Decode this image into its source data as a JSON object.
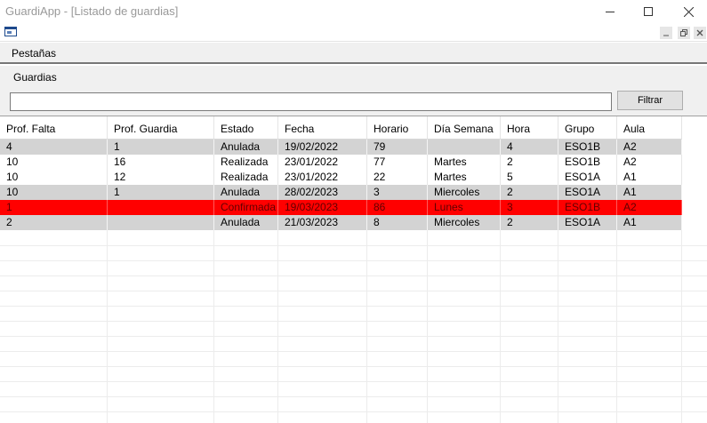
{
  "window": {
    "title": "GuardiApp - [Listado de guardias]"
  },
  "menu": {
    "items": [
      {
        "label": "Pestañas"
      }
    ]
  },
  "tabs": [
    {
      "label": "Guardias"
    }
  ],
  "filter": {
    "value": "",
    "button_label": "Filtrar"
  },
  "table": {
    "columns": [
      "Prof. Falta",
      "Prof. Guardia",
      "Estado",
      "Fecha",
      "Horario",
      "Día Semana",
      "Hora",
      "Grupo",
      "Aula"
    ],
    "rows": [
      [
        "4",
        "1",
        "Anulada",
        "19/02/2022",
        "79",
        "",
        "4",
        "ESO1B",
        "A2"
      ],
      [
        "10",
        "16",
        "Realizada",
        "23/01/2022",
        "77",
        "Martes",
        "2",
        "ESO1B",
        "A2"
      ],
      [
        "10",
        "12",
        "Realizada",
        "23/01/2022",
        "22",
        "Martes",
        "5",
        "ESO1A",
        "A1"
      ],
      [
        "10",
        "1",
        "Anulada",
        "28/02/2023",
        "3",
        "Miercoles",
        "2",
        "ESO1A",
        "A1"
      ],
      [
        "1",
        "",
        "Confirmada",
        "19/03/2023",
        "86",
        "Lunes",
        "3",
        "ESO1B",
        "A2"
      ],
      [
        "2",
        "",
        "Anulada",
        "21/03/2023",
        "8",
        "Miercoles",
        "2",
        "ESO1A",
        "A1"
      ]
    ],
    "row_styles": [
      "alt",
      "",
      "",
      "alt",
      "confirmed",
      "alt"
    ]
  },
  "colors": {
    "confirmed_row": "#ff0000",
    "alt_row": "#d3d3d3"
  }
}
